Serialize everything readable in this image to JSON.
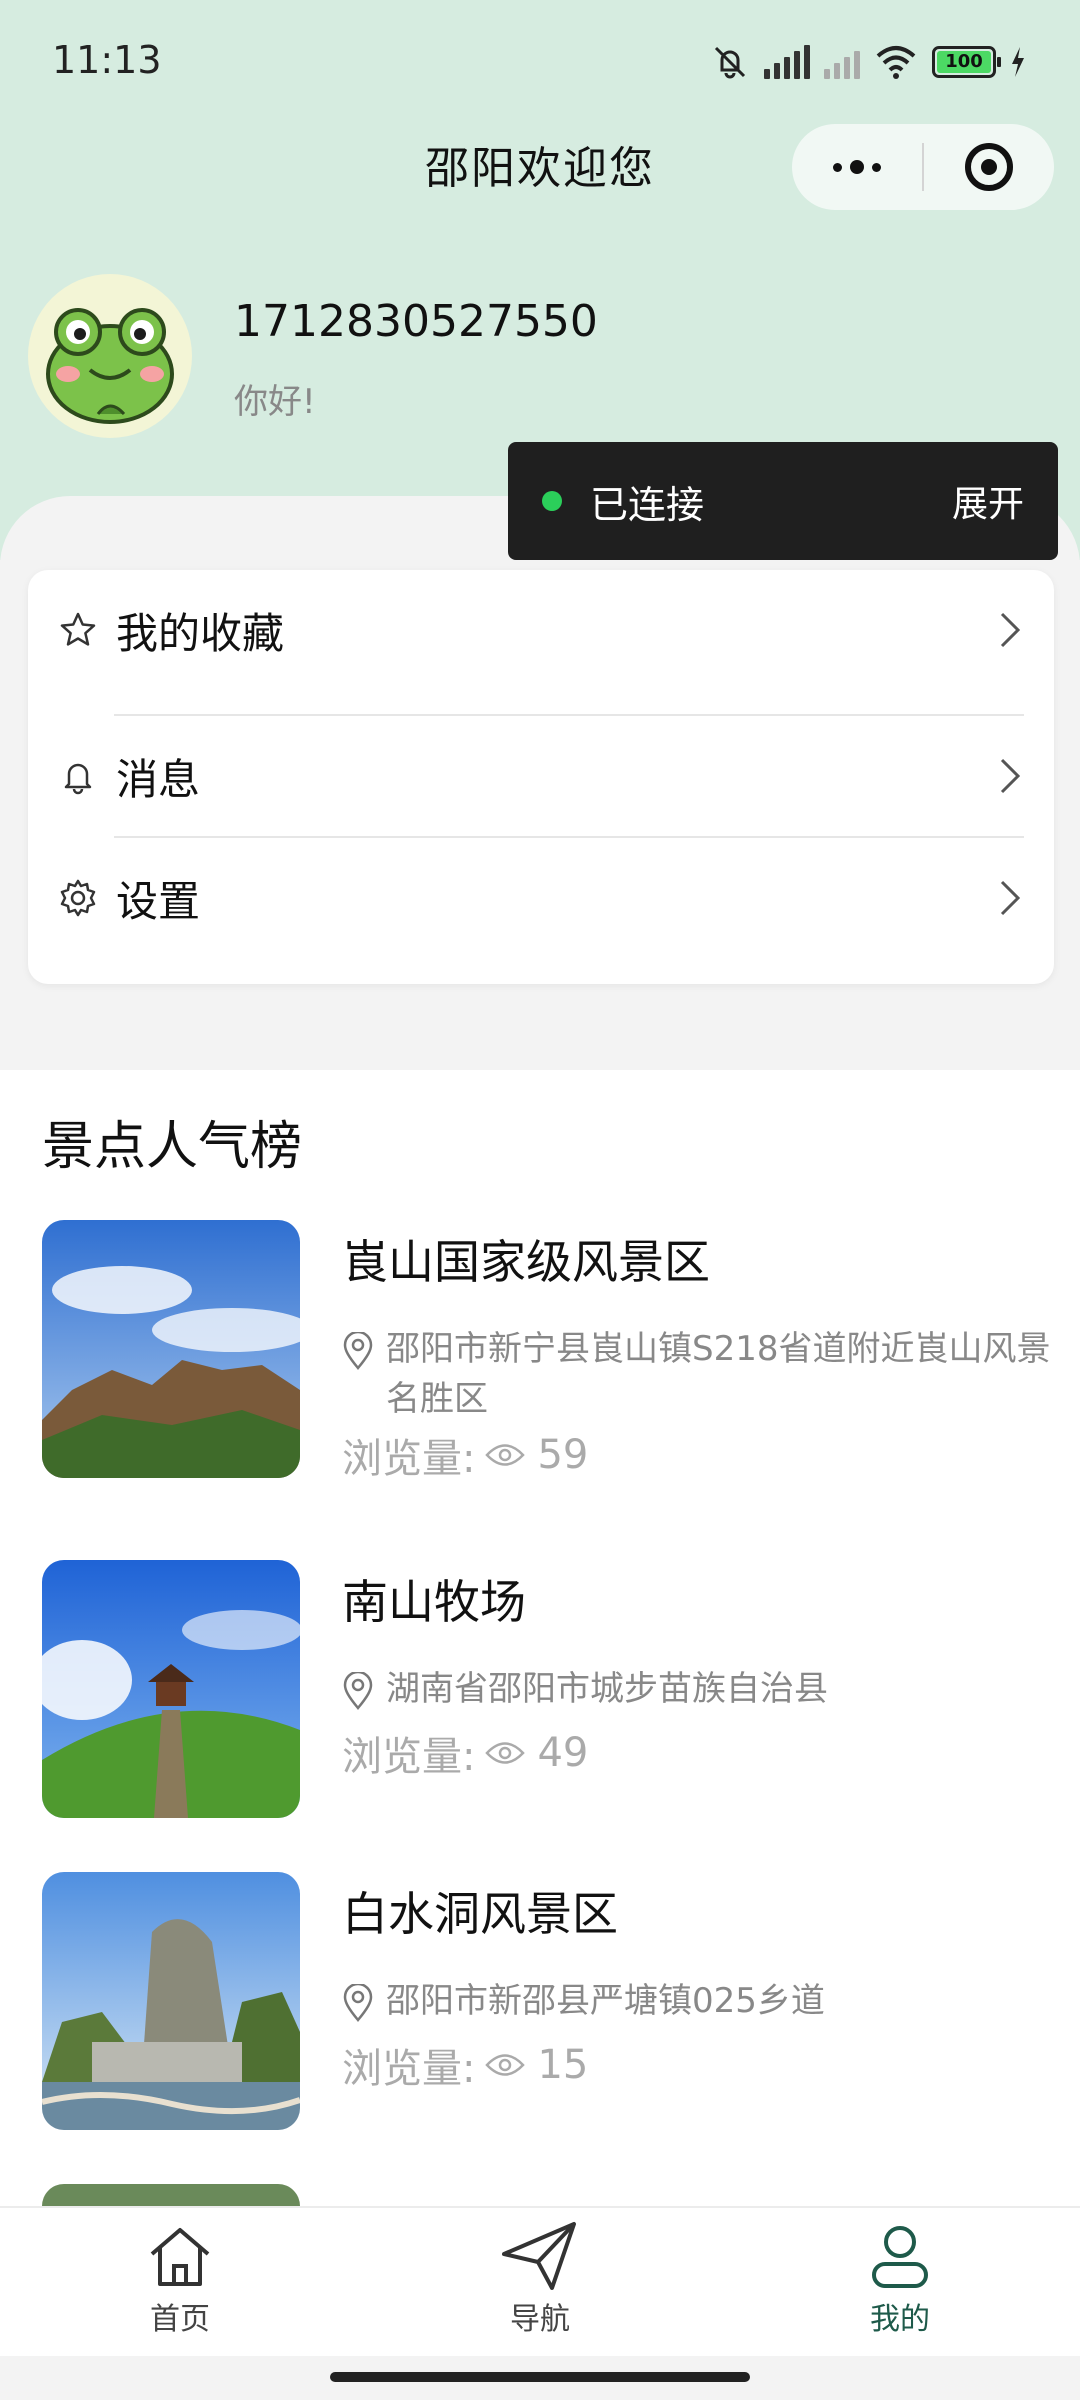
{
  "status": {
    "time": "11:13",
    "battery": "100"
  },
  "nav": {
    "title": "邵阳欢迎您"
  },
  "profile": {
    "name": "1712830527550",
    "greeting": "你好!"
  },
  "connection": {
    "status": "已连接",
    "expand": "展开"
  },
  "menu": {
    "items": [
      {
        "label": "我的收藏",
        "icon": "star-icon"
      },
      {
        "label": "消息",
        "icon": "bell-icon"
      },
      {
        "label": "设置",
        "icon": "gear-icon"
      }
    ]
  },
  "ranking": {
    "title": "景点人气榜",
    "views_label": "浏览量:",
    "spots": [
      {
        "name": "崀山国家级风景区",
        "address": "邵阳市新宁县崀山镇S218省道附近崀山风景名胜区",
        "views": "59"
      },
      {
        "name": "南山牧场",
        "address": "湖南省邵阳市城步苗族自治县",
        "views": "49"
      },
      {
        "name": "白水洞风景区",
        "address": "邵阳市新邵县严塘镇025乡道",
        "views": "15"
      }
    ]
  },
  "tabbar": {
    "items": [
      {
        "label": "首页",
        "icon": "home-icon"
      },
      {
        "label": "导航",
        "icon": "paper-plane-icon"
      },
      {
        "label": "我的",
        "icon": "user-icon"
      }
    ],
    "active": "我的"
  },
  "colors": {
    "header_bg": "#d6ece0",
    "accent": "#1e5a4a",
    "connected_dot": "#2bcf5a"
  }
}
